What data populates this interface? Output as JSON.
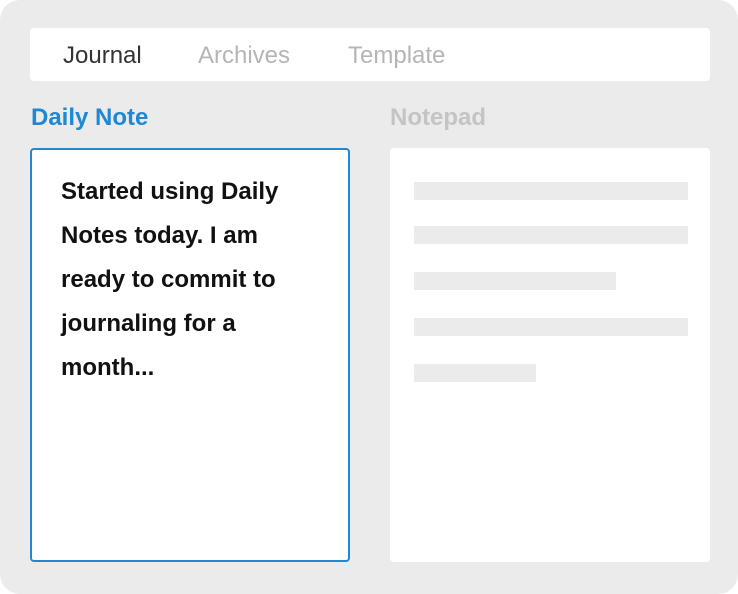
{
  "tabs": [
    {
      "label": "Journal",
      "active": true
    },
    {
      "label": "Archives",
      "active": false
    },
    {
      "label": "Template",
      "active": false
    }
  ],
  "daily_note": {
    "title": "Daily Note",
    "text": "Started using Daily Notes today. I am ready to commit to journaling for a month..."
  },
  "notepad": {
    "title": "Notepad",
    "placeholder_line_count": 5
  },
  "colors": {
    "accent": "#1e88d4",
    "inactive": "#c4c4c4",
    "background": "#ebebeb",
    "placeholder": "#ebebeb"
  }
}
